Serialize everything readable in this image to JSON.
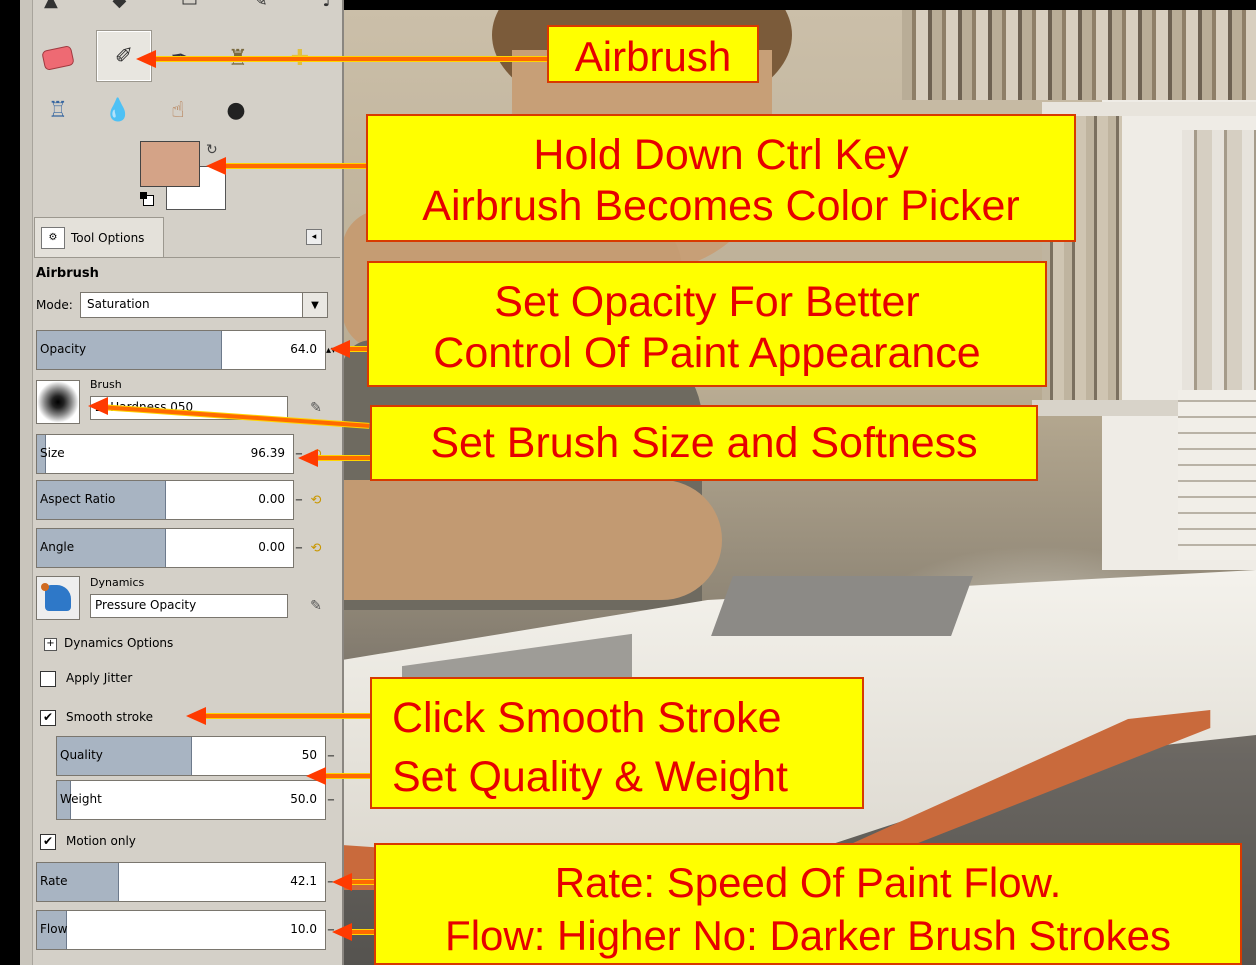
{
  "tool_options": {
    "tab_label": "Tool Options",
    "tool_name": "Airbrush",
    "mode_label": "Mode:",
    "mode_value": "Saturation",
    "opacity": {
      "label": "Opacity",
      "value": "64.0",
      "fraction": 0.64
    },
    "brush": {
      "label": "Brush",
      "value": "2. Hardness 050"
    },
    "size": {
      "label": "Size",
      "value": "96.39",
      "fraction": 0.03
    },
    "aspect_ratio": {
      "label": "Aspect Ratio",
      "value": "0.00",
      "fraction": 0.5
    },
    "angle": {
      "label": "Angle",
      "value": "0.00",
      "fraction": 0.5
    },
    "dynamics": {
      "label": "Dynamics",
      "value": "Pressure Opacity"
    },
    "dynamics_options_label": "Dynamics Options",
    "apply_jitter": {
      "label": "Apply Jitter",
      "checked": false
    },
    "smooth_stroke": {
      "label": "Smooth stroke",
      "checked": true
    },
    "quality": {
      "label": "Quality",
      "value": "50",
      "fraction": 0.5
    },
    "weight": {
      "label": "Weight",
      "value": "50.0",
      "fraction": 0.05
    },
    "motion_only": {
      "label": "Motion only",
      "checked": true
    },
    "rate": {
      "label": "Rate",
      "value": "42.1",
      "fraction": 0.28
    },
    "flow": {
      "label": "Flow",
      "value": "10.0",
      "fraction": 0.1
    }
  },
  "colors": {
    "foreground": "#d4a387",
    "background": "#ffffff",
    "callout_fill": "#ffff00",
    "callout_text": "#e60000"
  },
  "toolbox_icons": [
    "eraser-icon",
    "airbrush-icon",
    "ink-icon",
    "clone-icon",
    "heal-icon",
    "perspective-clone-icon",
    "blur-icon",
    "smudge-icon",
    "dodge-burn-icon"
  ],
  "callouts": {
    "airbrush": "Airbrush",
    "ctrl_line1": "Hold Down Ctrl Key",
    "ctrl_line2": "Airbrush Becomes Color Picker",
    "opacity_line1": "Set Opacity For Better",
    "opacity_line2": "Control Of Paint Appearance",
    "brush_size": "Set Brush Size and Softness",
    "smooth_line1": "Click Smooth Stroke",
    "smooth_line2": "Set Quality & Weight",
    "rate_line1": "Rate: Speed Of Paint Flow.",
    "rate_line2": "Flow: Higher No: Darker Brush Strokes"
  }
}
